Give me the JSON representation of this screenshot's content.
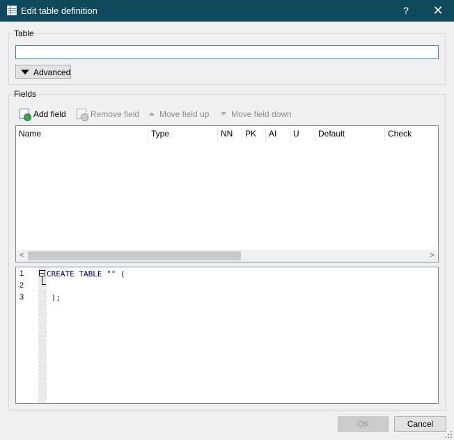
{
  "window": {
    "title": "Edit table definition",
    "help_glyph": "?",
    "close_glyph": "✕",
    "icon": "table-icon",
    "titlebar_color": "#0e4a5c"
  },
  "table_section": {
    "legend": "Table",
    "name_value": "",
    "advanced_label": "Advanced"
  },
  "fields_section": {
    "legend": "Fields",
    "toolbar": {
      "add_field": "Add field",
      "remove_field": "Remove field",
      "move_up": "Move field up",
      "move_down": "Move field down"
    },
    "columns": [
      "Name",
      "Type",
      "NN",
      "PK",
      "AI",
      "U",
      "Default",
      "Check"
    ],
    "rows": [],
    "scroll_left_glyph": "<",
    "scroll_right_glyph": ">"
  },
  "sql_preview": {
    "line_numbers": [
      "1",
      "2",
      "3"
    ],
    "line1": {
      "kw": "CREATE TABLE",
      "str": "\"\"",
      "rest": "("
    },
    "line2": "",
    "line3": ");"
  },
  "buttons": {
    "ok": "OK",
    "cancel": "Cancel",
    "ok_enabled": false
  }
}
